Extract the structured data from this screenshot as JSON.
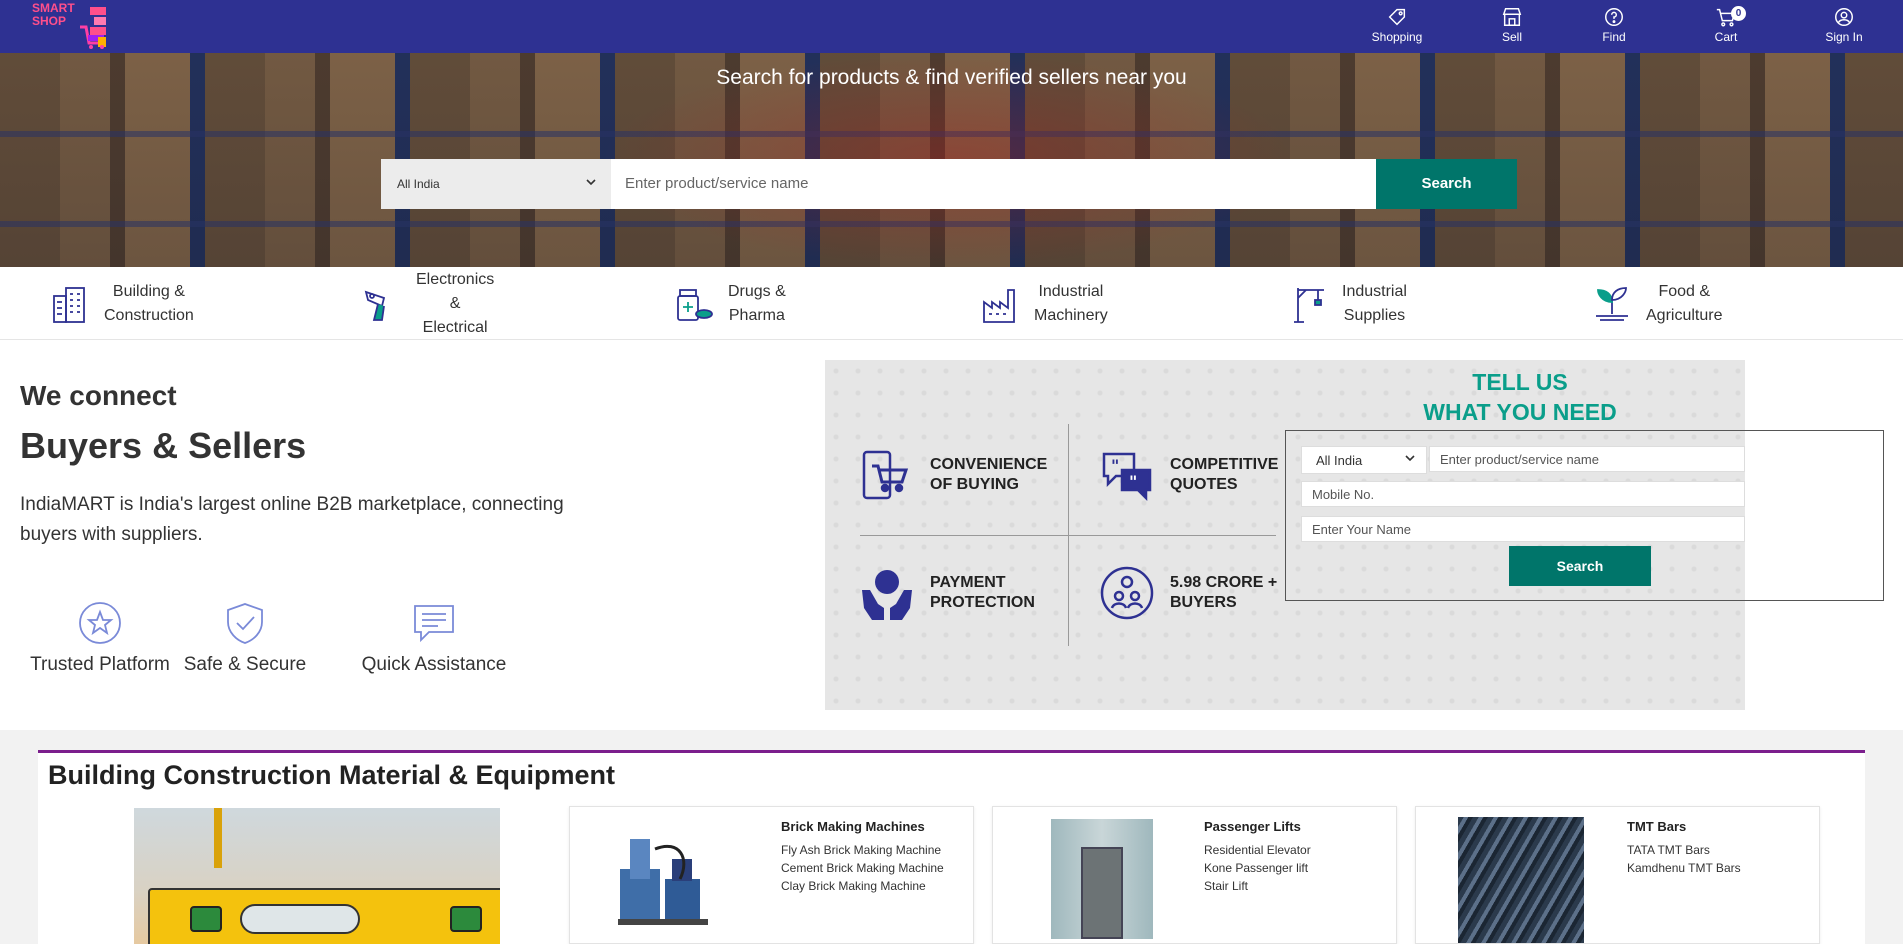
{
  "brand": {
    "logo_text": "SMART SHOP",
    "primary": "#2e3192",
    "accent": "#00756a",
    "teal_text": "#0a9e8a"
  },
  "topnav": {
    "items": [
      {
        "label": "Shopping",
        "icon": "tag-icon"
      },
      {
        "label": "Sell",
        "icon": "storefront-icon"
      },
      {
        "label": "Find",
        "icon": "help-circle-icon"
      },
      {
        "label": "Cart",
        "icon": "cart-icon",
        "badge": "0"
      },
      {
        "label": "Sign In",
        "icon": "user-circle-icon"
      }
    ]
  },
  "hero": {
    "title": "Search for products & find verified sellers near you",
    "location": "All India",
    "placeholder": "Enter product/service name",
    "search_label": "Search"
  },
  "categories": [
    {
      "line1": "Building &",
      "line2": "Construction",
      "icon": "building-icon"
    },
    {
      "line1": "Electronics",
      "line2": "&",
      "line3": "Electrical",
      "icon": "drill-icon"
    },
    {
      "line1": "Drugs &",
      "line2": "Pharma",
      "icon": "medicine-icon"
    },
    {
      "line1": "Industrial",
      "line2": "Machinery",
      "icon": "factory-icon"
    },
    {
      "line1": "Industrial",
      "line2": "Supplies",
      "icon": "crane-icon"
    },
    {
      "line1": "Food &",
      "line2": "Agriculture",
      "icon": "plant-icon"
    }
  ],
  "intro": {
    "line1": "We connect",
    "line2": "Buyers & Sellers",
    "desc": "IndiaMART is India's largest online B2B marketplace, connecting buyers with suppliers.",
    "features": [
      {
        "label": "Trusted Platform",
        "icon": "star-badge-icon"
      },
      {
        "label": "Safe & Secure",
        "icon": "shield-check-icon"
      },
      {
        "label": "Quick Assistance",
        "icon": "chat-icon"
      }
    ]
  },
  "tell_us": {
    "title_line1": "TELL US",
    "title_line2": "WHAT YOU NEED",
    "features": [
      {
        "line1": "CONVENIENCE",
        "line2": "OF BUYING",
        "icon": "mobile-cart-icon"
      },
      {
        "line1": "COMPETITIVE",
        "line2": "QUOTES",
        "icon": "quote-bubbles-icon"
      },
      {
        "line1": "PAYMENT",
        "line2": "PROTECTION",
        "icon": "hands-protect-icon"
      },
      {
        "line1": "5.98 CRORE +",
        "line2": "BUYERS",
        "icon": "users-circle-icon"
      }
    ],
    "form": {
      "location": "All India",
      "product_placeholder": "Enter product/service name",
      "mobile_placeholder": "Mobile No.",
      "name_placeholder": "Enter Your Name",
      "search_label": "Search"
    }
  },
  "section": {
    "title": "Building Construction Material & Equipment",
    "products": [
      {
        "title": "Brick Making Machines",
        "items": [
          "Fly Ash Brick Making Machine",
          "Cement Brick Making Machine",
          "Clay Brick Making Machine"
        ]
      },
      {
        "title": "Passenger Lifts",
        "items": [
          "Residential Elevator",
          "Kone Passenger lift",
          "Stair Lift"
        ]
      },
      {
        "title": "TMT Bars",
        "items": [
          "TATA TMT Bars",
          "Kamdhenu TMT Bars"
        ]
      }
    ]
  }
}
